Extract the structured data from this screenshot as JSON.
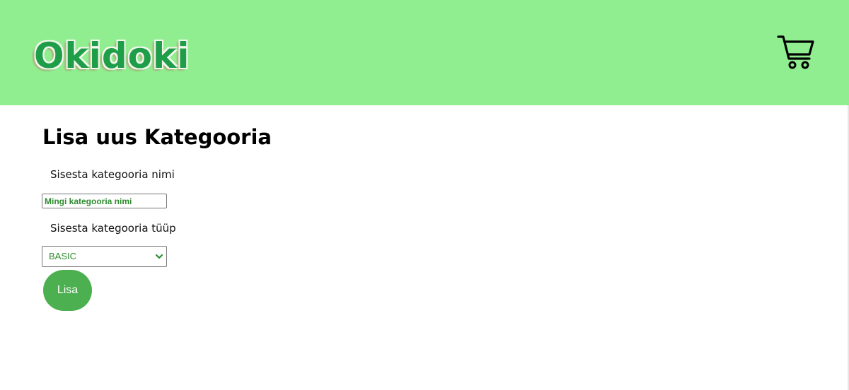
{
  "header": {
    "logo_text": "Okidoki",
    "cart_icon": "shopping-cart-icon",
    "background_color": "#90ee90"
  },
  "form": {
    "title": "Lisa uus Kategooria",
    "name_label": "Sisesta kategooria nimi",
    "name_value": "Mingi kategooria nimi",
    "type_label": "Sisesta kategooria tüüp",
    "type_selected": "BASIC",
    "submit_label": "Lisa",
    "accent_color": "#4caf50",
    "value_text_color": "#2e8b2e"
  }
}
